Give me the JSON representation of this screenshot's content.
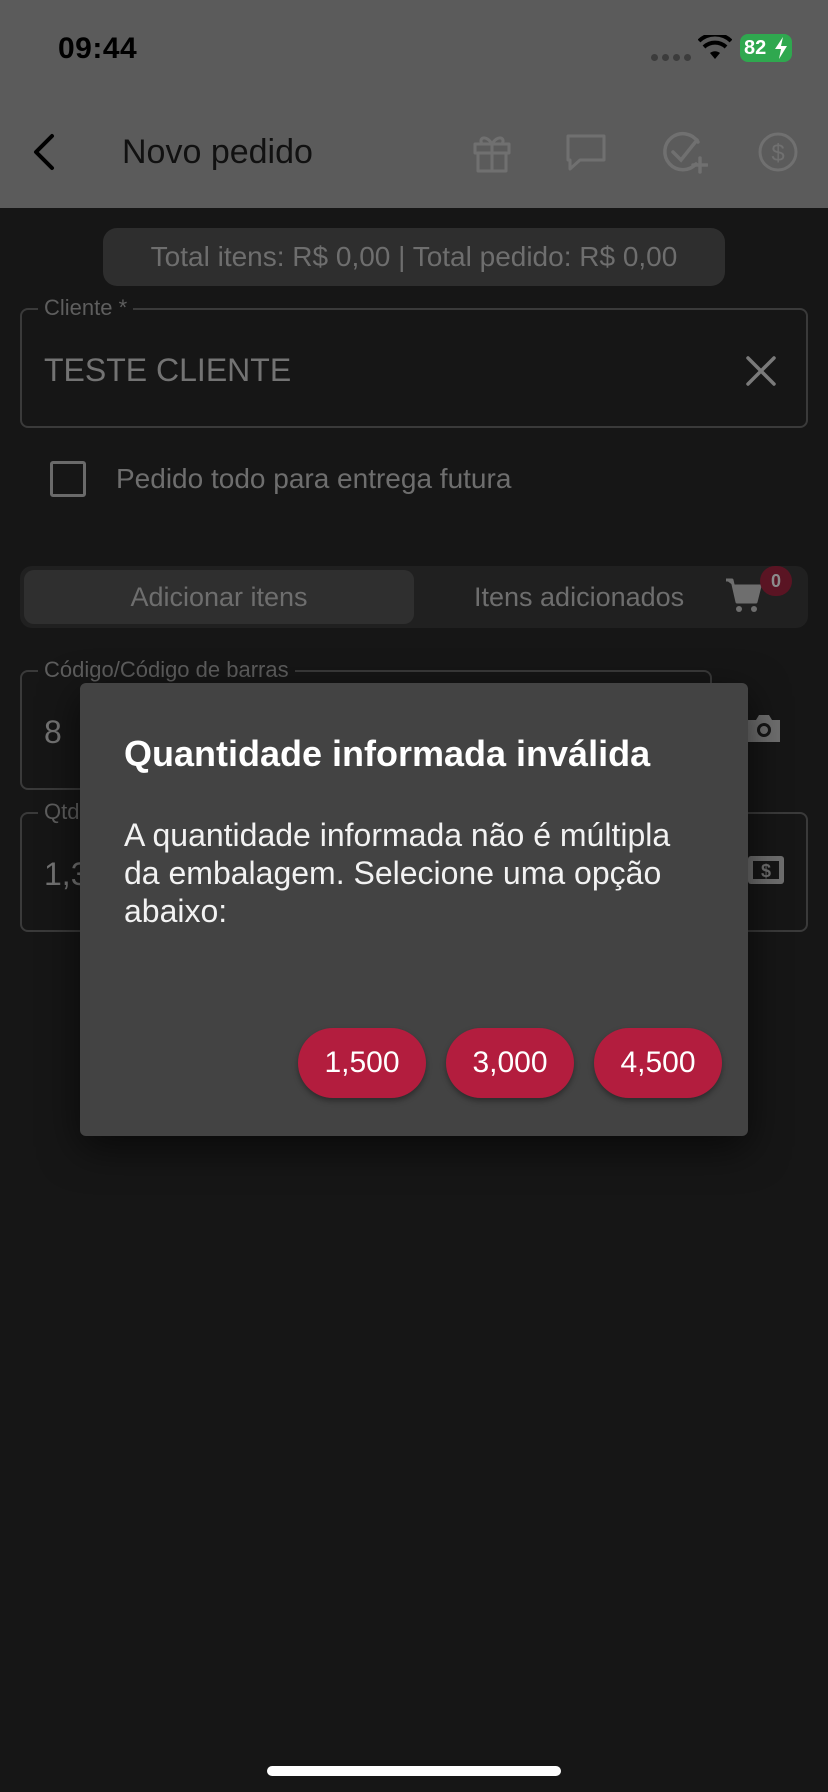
{
  "status_bar": {
    "time": "09:44",
    "battery": "82"
  },
  "app_bar": {
    "title": "Novo pedido",
    "icons": [
      "back-icon",
      "gift-icon",
      "chat-icon",
      "check-add-icon",
      "dollar-icon"
    ]
  },
  "totals": {
    "text": "Total itens: R$ 0,00 | Total pedido: R$ 0,00"
  },
  "client_field": {
    "label": "Cliente *",
    "value": "TESTE CLIENTE"
  },
  "future_delivery": {
    "label": "Pedido todo para entrega futura",
    "checked": false
  },
  "tabs": {
    "add_items": "Adicionar itens",
    "added_items": "Itens adicionados",
    "cart_count": "0"
  },
  "code_field": {
    "label": "Código/Código de barras",
    "value": "8"
  },
  "qty_field": {
    "label": "Qtd",
    "value": "1,3"
  },
  "dialog": {
    "title": "Quantidade informada inválida",
    "message": "A quantidade informada não é múltipla da embalagem. Selecione uma opção abaixo:",
    "options": [
      "1,500",
      "3,000",
      "4,500"
    ],
    "button_color": "#b31d3e"
  }
}
